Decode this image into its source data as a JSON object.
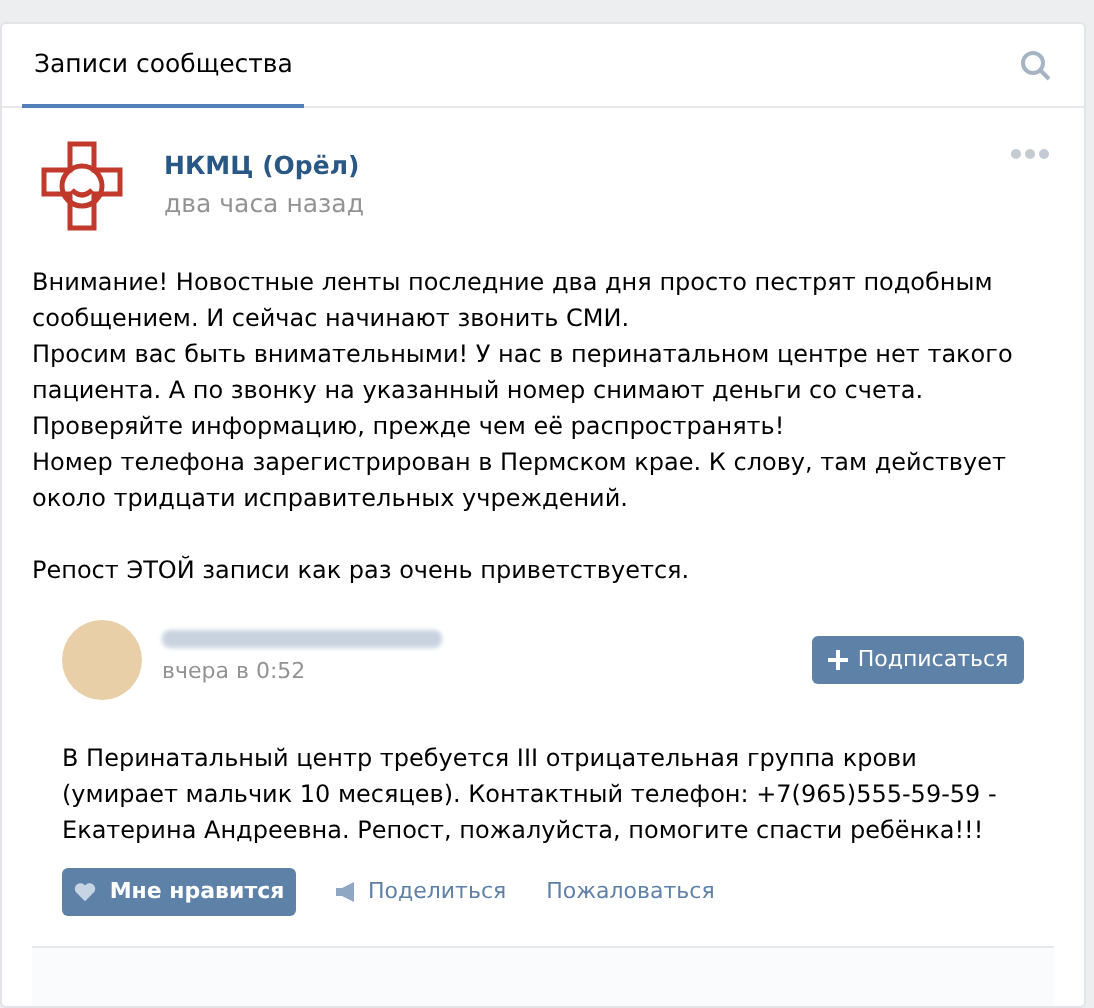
{
  "tabs": [
    {
      "label": "Записи сообщества",
      "selected": true
    }
  ],
  "post": {
    "author": "НКМЦ (Орёл)",
    "time": "два часа назад",
    "blocks": [
      [
        "Внимание! Новостные ленты последние два дня просто пестрят подобным сообщением. И сейчас начинают звонить СМИ.",
        "Просим вас быть внимательными! У нас в перинатальном центре нет такого пациента. А по звонку на указанный номер снимают деньги со счета.",
        "Проверяйте информацию, прежде чем её распространять!",
        "Номер телефона зарегистрирован в Пермском крае. К слову, там действует около тридцати исправительных учреждений."
      ],
      [
        "Репост ЭТОЙ записи как раз очень приветствуется."
      ]
    ],
    "repost": {
      "time": "вчера в 0:52",
      "subscribe": "Подписаться",
      "text": "В Перинатальный центр требуется III отрицательная группа крови (умирает мальчик 10 месяцев). Контактный телефон: +7(965)555-59-59 - Екатерина Андреевна. Репост, пожалуйста, помогите спасти ребёнка!!!",
      "actions": [
        {
          "kind": "like",
          "label": "Мне нравится"
        },
        {
          "kind": "share",
          "label": "Поделиться"
        },
        {
          "kind": "report",
          "label": "Пожаловаться"
        }
      ]
    }
  }
}
